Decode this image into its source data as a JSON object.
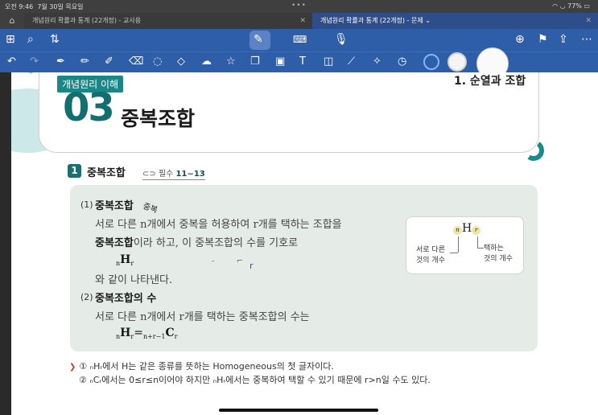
{
  "status": {
    "time": "오전 9:46",
    "date": "7월 30일 목요일",
    "dots": "•••",
    "battery": "77%"
  },
  "tabs": [
    {
      "label": "개념원리 확률과 통계 (22개정) - 교사용"
    },
    {
      "label": "개념원리 확률과 통계 (22개정) - 문제 ⌄"
    }
  ],
  "icons": {
    "home": "home-icon",
    "grid": "grid-icon",
    "search": "search-icon",
    "share_hand": "transfer-icon",
    "pen_mode": "pen-mode-icon",
    "keyboard": "keyboard-icon",
    "mic": "mic-icon",
    "add_page": "add-page-icon",
    "bookmark": "bookmark-icon",
    "share": "share-icon",
    "more": "more-icon",
    "undo": "undo-icon",
    "redo": "redo-icon"
  },
  "header": {
    "tag": "개념원리 이해",
    "chapter_number": "03",
    "chapter_title": "중복조합",
    "section_title": "1. 순열과 조합"
  },
  "section": {
    "number": "1",
    "title": "중복조합",
    "ref_label": "필수",
    "ref_range": "11~13"
  },
  "content": {
    "item1_num": "(1)",
    "item1_title": "중복조합",
    "item1_line1": "서로 다른 n개에서 중복을 허용하여 r개를 택하는 조합을",
    "item1_line2_bold": "중복조합",
    "item1_line2_rest": "이라 하고, 이 중복조합의 수를 기호로",
    "item1_symbol": "H",
    "item1_line4": "와 같이 나타낸다.",
    "item2_num": "(2)",
    "item2_title": "중복조합의 수",
    "item2_line1": "서로 다른 n개에서 r개를 택하는 중복조합의 수는",
    "formula_lhs": "H",
    "formula_eq": "=",
    "formula_rhs": "C",
    "formula_rhs_sub": "n+r−1",
    "sub_n": "n",
    "sub_r": "r"
  },
  "annotations": {
    "a1": "중복",
    "a2": "-",
    "a3": "⌐",
    "a4": "r"
  },
  "diagram": {
    "left_label1": "서로 다른",
    "left_label2": "것의 개수",
    "right_label1": "택하는",
    "right_label2": "것의 개수"
  },
  "notes": {
    "n1": "① ₙHᵣ에서 H는 같은 종류를 뜻하는 Homogeneous의 첫 글자이다.",
    "n2": "② ₙCᵣ에서는 0≤r≤n이어야 하지만 ₙHᵣ에서는 중복하여 택할 수 있기 때문에 r>n일 수도 있다."
  },
  "colors": {
    "toolbar": "#2f5ea8",
    "teal": "#1b8686",
    "box_bg": "#e5ebe7"
  }
}
